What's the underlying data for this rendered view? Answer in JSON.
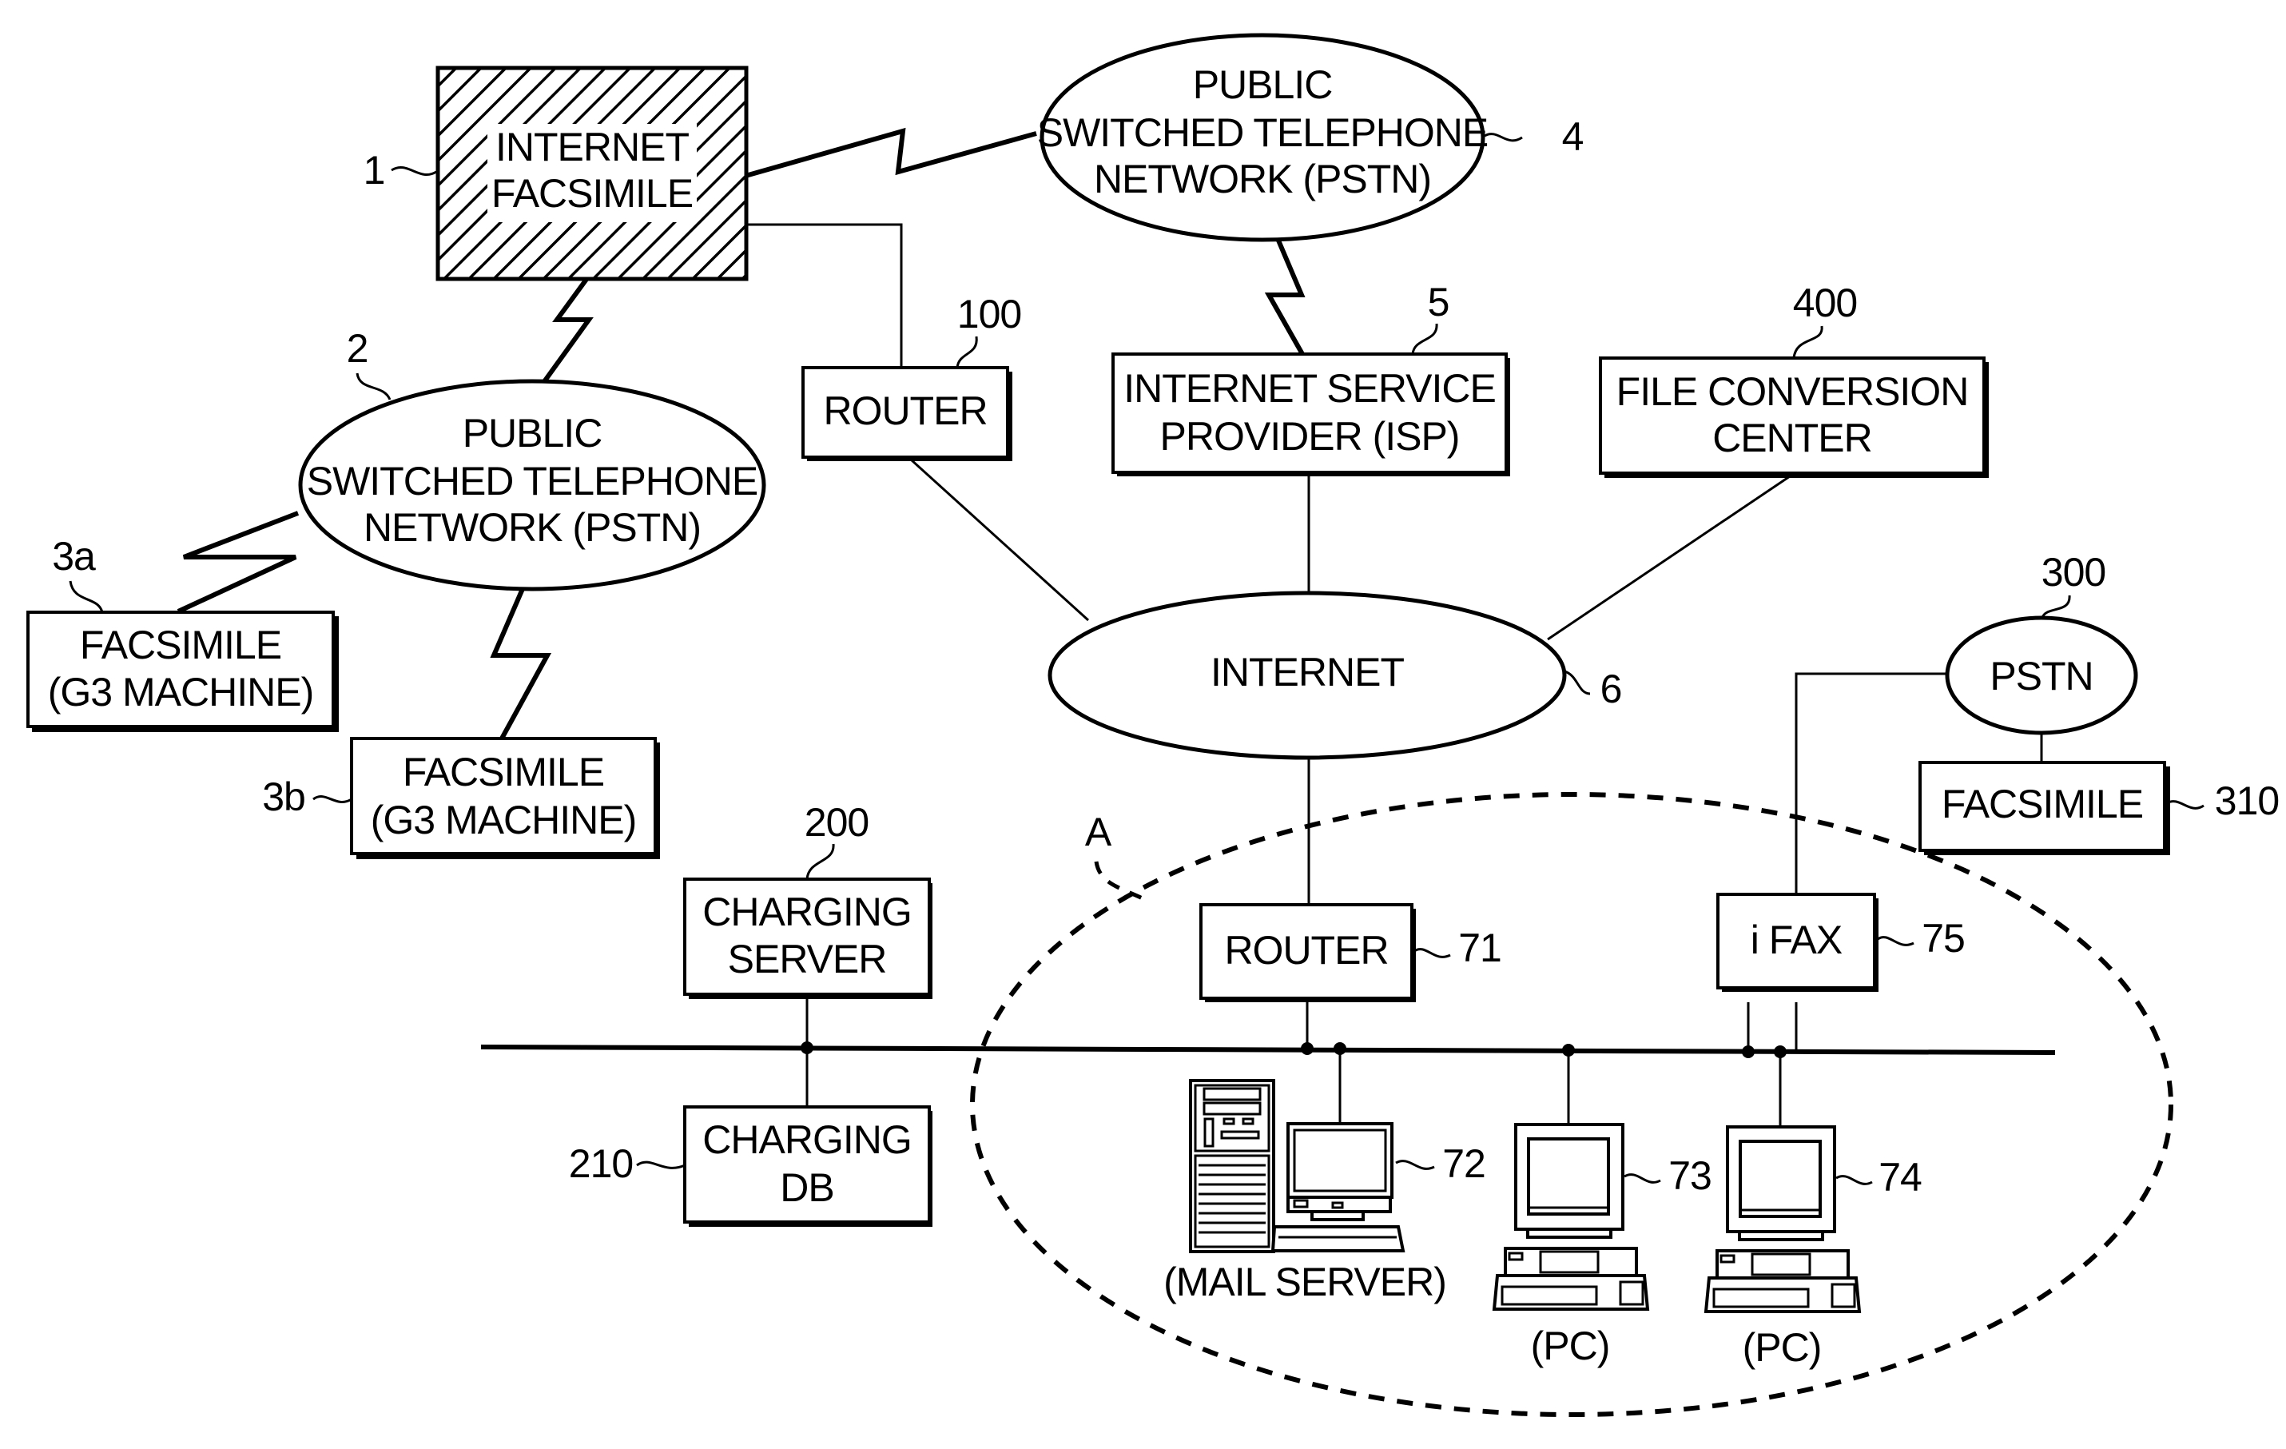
{
  "figure": {
    "nodes": {
      "internet_facsimile": {
        "ref": "1",
        "lines": [
          "INTERNET",
          "FACSIMILE"
        ]
      },
      "pstn_top": {
        "ref": "4",
        "lines": [
          "PUBLIC",
          "SWITCHED TELEPHONE",
          "NETWORK (PSTN)"
        ]
      },
      "pstn_left": {
        "ref": "2",
        "lines": [
          "PUBLIC",
          "SWITCHED TELEPHONE",
          "NETWORK (PSTN)"
        ]
      },
      "facsimile_3a": {
        "ref": "3a",
        "lines": [
          "FACSIMILE",
          "(G3 MACHINE)"
        ]
      },
      "facsimile_3b": {
        "ref": "3b",
        "lines": [
          "FACSIMILE",
          "(G3 MACHINE)"
        ]
      },
      "router_100": {
        "ref": "100",
        "lines": [
          "ROUTER"
        ]
      },
      "isp": {
        "ref": "5",
        "lines": [
          "INTERNET SERVICE",
          "PROVIDER (ISP)"
        ]
      },
      "file_conversion_center": {
        "ref": "400",
        "lines": [
          "FILE CONVERSION",
          "CENTER"
        ]
      },
      "internet": {
        "ref": "6",
        "lines": [
          "INTERNET"
        ]
      },
      "pstn_300": {
        "ref": "300",
        "lines": [
          "PSTN"
        ]
      },
      "facsimile_310": {
        "ref": "310",
        "lines": [
          "FACSIMILE"
        ]
      },
      "charging_server": {
        "ref": "200",
        "lines": [
          "CHARGING",
          "SERVER"
        ]
      },
      "charging_db": {
        "ref": "210",
        "lines": [
          "CHARGING",
          "DB"
        ]
      },
      "router_71": {
        "ref": "71",
        "lines": [
          "ROUTER"
        ]
      },
      "ifax": {
        "ref": "75",
        "lines": [
          "i FAX"
        ]
      },
      "mail_server": {
        "ref": "72",
        "caption": "(MAIL SERVER)"
      },
      "pc_73": {
        "ref": "73",
        "caption": "(PC)"
      },
      "pc_74": {
        "ref": "74",
        "caption": "(PC)"
      }
    },
    "region_label": "A"
  }
}
